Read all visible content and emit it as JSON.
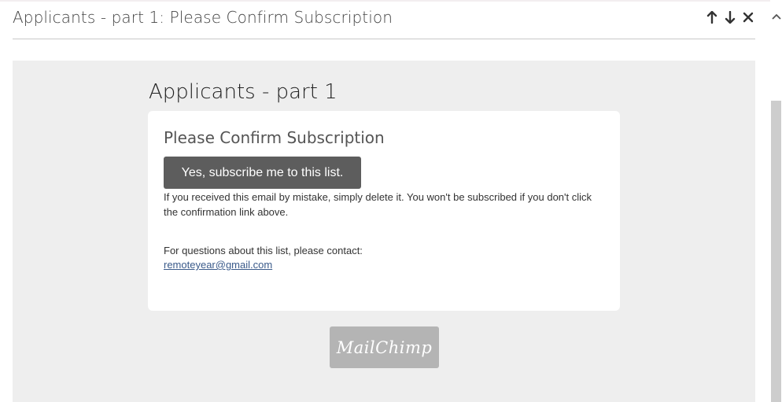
{
  "header": {
    "title": "Applicants - part 1: Please Confirm Subscription",
    "actions": [
      {
        "icon": "arrow-up-icon"
      },
      {
        "icon": "arrow-down-icon"
      },
      {
        "icon": "close-icon"
      }
    ]
  },
  "email": {
    "list_name": "Applicants - part 1",
    "card_title": "Please Confirm Subscription",
    "confirm_button": "Yes, subscribe me to this list.",
    "mistake_notice": "If you received this email by mistake, simply delete it. You won't be subscribed if you don't click the confirmation link above.",
    "contact_prompt": "For questions about this list, please contact:",
    "contact_email": "remoteyear@gmail.com",
    "badge": "MailChimp"
  },
  "colors": {
    "background": "#eeeeee",
    "button": "#5d5d5d",
    "link": "#3a5a8a",
    "badge": "#b4b4b4"
  }
}
